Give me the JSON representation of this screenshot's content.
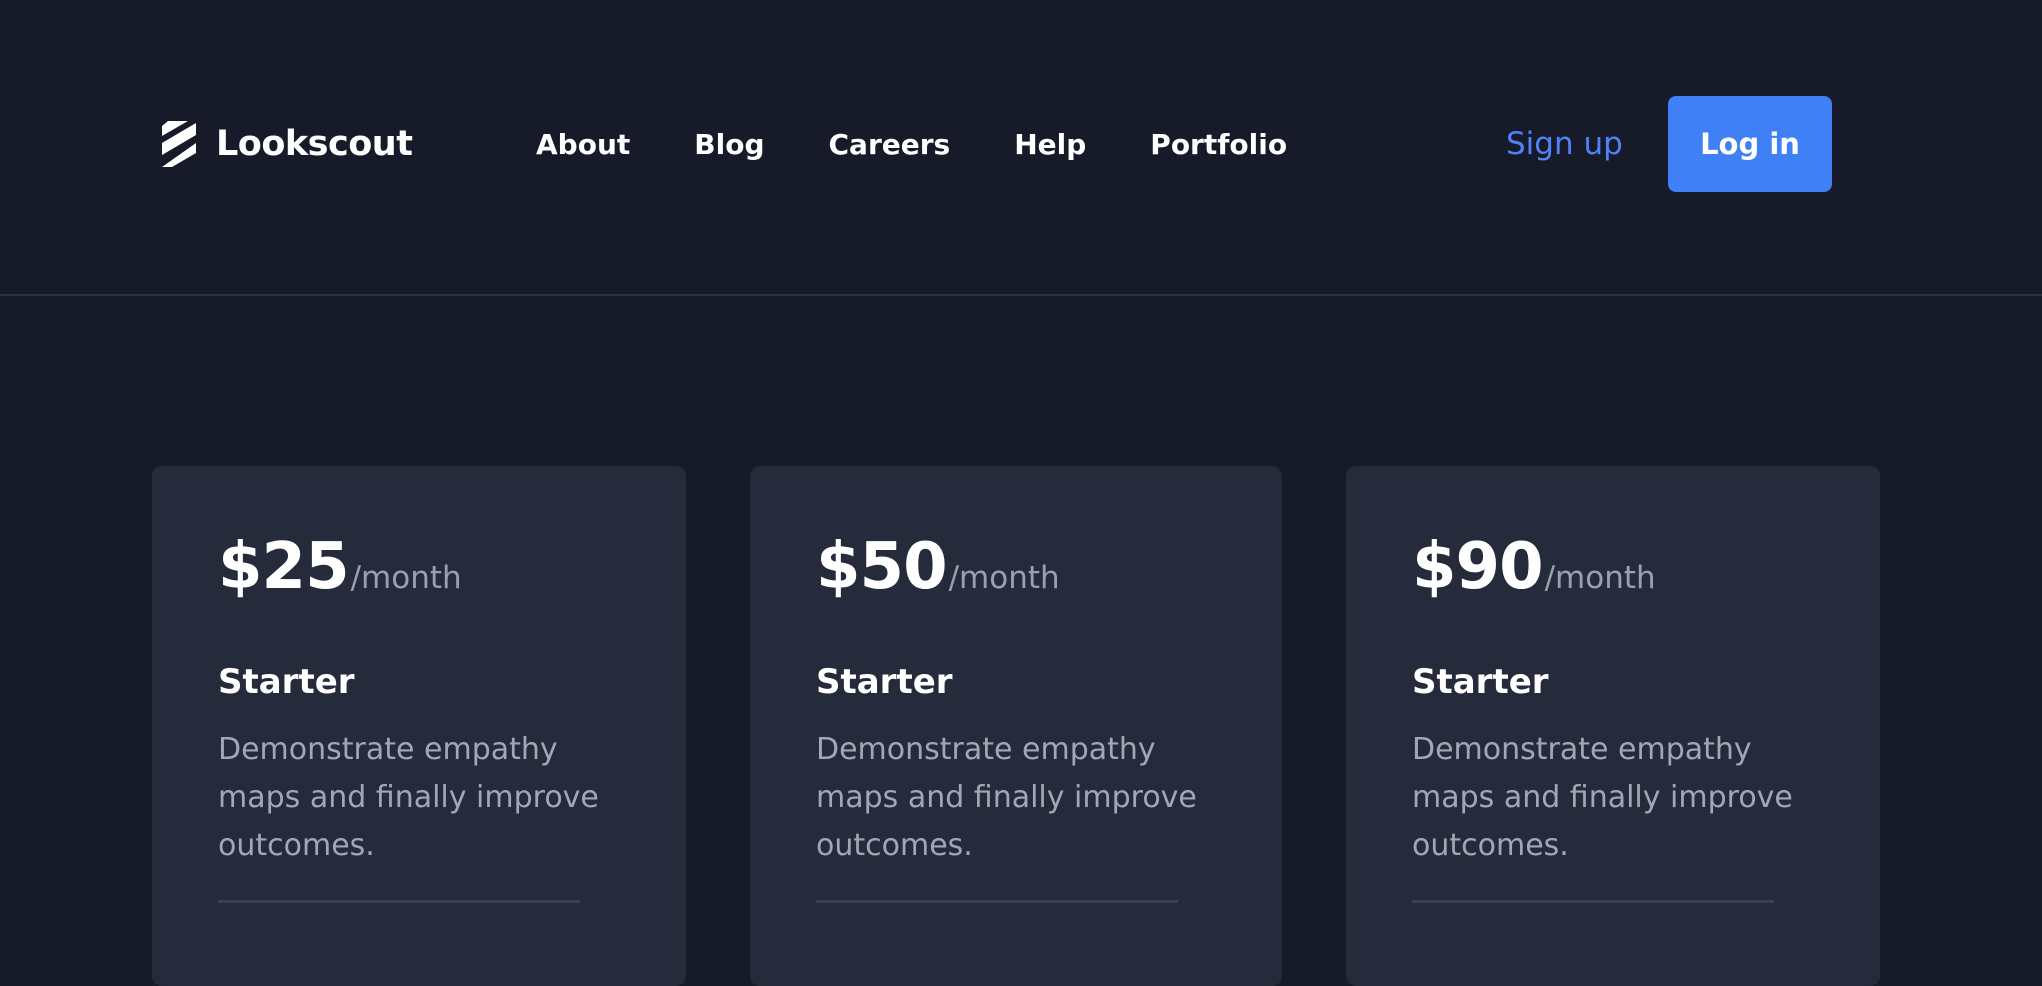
{
  "brand": {
    "name": "Lookscout",
    "logo_icon": "diagonal-stripes-logo-icon"
  },
  "nav": {
    "items": [
      "About",
      "Blog",
      "Careers",
      "Help",
      "Portfolio"
    ]
  },
  "auth": {
    "signup_label": "Sign up",
    "login_label": "Log in"
  },
  "colors": {
    "background": "#171b29",
    "card": "#252b3b",
    "accent": "#4080f6",
    "link": "#4f82f5",
    "muted_text": "#a0a7b6"
  },
  "pricing": {
    "cards": [
      {
        "price": "$25",
        "period": "/month",
        "name": "Starter",
        "description": "Demonstrate empathy maps and finally improve outcomes."
      },
      {
        "price": "$50",
        "period": "/month",
        "name": "Starter",
        "description": "Demonstrate empathy maps and finally improve outcomes."
      },
      {
        "price": "$90",
        "period": "/month",
        "name": "Starter",
        "description": "Demonstrate empathy maps and finally improve outcomes."
      }
    ]
  }
}
